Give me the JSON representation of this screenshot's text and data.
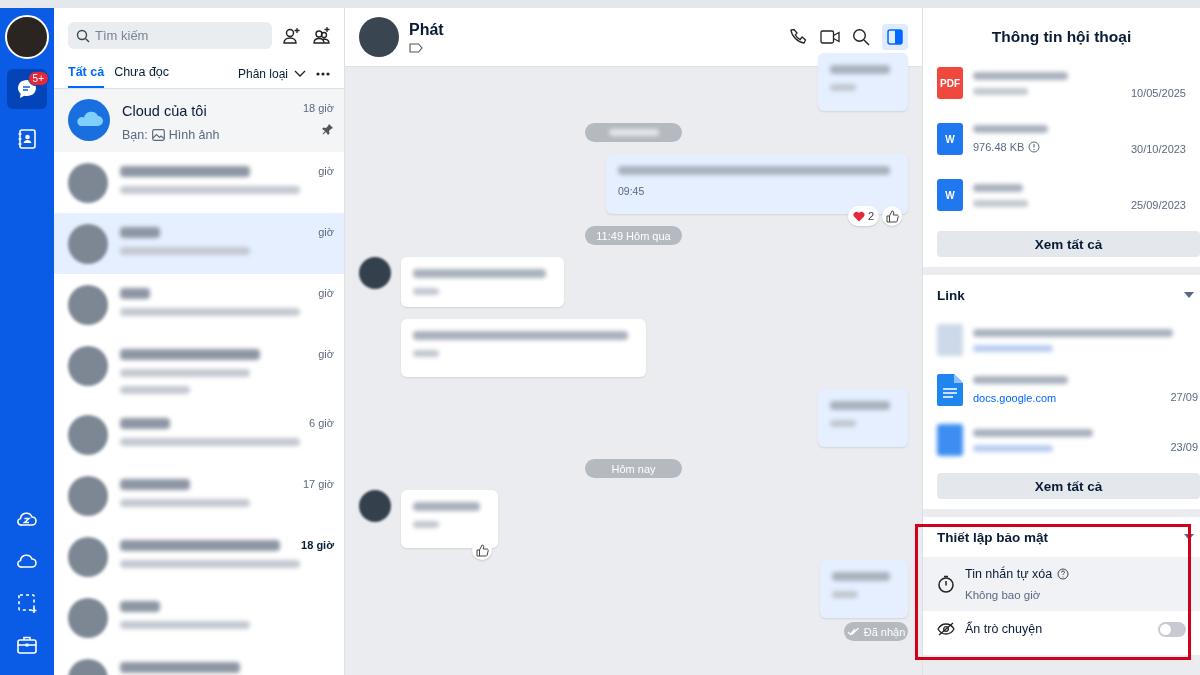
{
  "nav": {
    "badge": "5+",
    "items": [
      {
        "kind": "chat",
        "selected": true
      },
      {
        "kind": "contacts",
        "selected": false
      }
    ],
    "bottom": [
      {
        "kind": "cloud-z"
      },
      {
        "kind": "cloud"
      },
      {
        "kind": "capture"
      },
      {
        "kind": "briefcase"
      }
    ]
  },
  "chat_list": {
    "search": {
      "placeholder": "Tìm kiếm"
    },
    "tabs": [
      {
        "label": "Tất cả",
        "selected": true
      },
      {
        "label": "Chưa đọc",
        "selected": false
      }
    ],
    "filter": "Phân loại",
    "conversations": [
      {
        "name": "Cloud của tôi",
        "preview_prefix": "Bạn:",
        "preview": "Hình ảnh",
        "time": "18 giờ",
        "pinned": true,
        "selected": false
      },
      {
        "time": "giờ",
        "pinned": false,
        "selected": false
      },
      {
        "time": "giờ",
        "pinned": false,
        "selected": true
      },
      {
        "time": "giờ",
        "pinned": false,
        "selected": false
      },
      {
        "time": "giờ",
        "pinned": false,
        "selected": false
      },
      {
        "time": "6 giờ",
        "pinned": false,
        "selected": false
      },
      {
        "time": "17 giờ",
        "pinned": false,
        "selected": false
      },
      {
        "time": "18 giờ",
        "pinned": false,
        "selected": false,
        "unread": true
      },
      {
        "pinned": false,
        "selected": false
      },
      {
        "pinned": false,
        "selected": false
      }
    ]
  },
  "chat": {
    "name": "Phát",
    "messages": [
      {
        "kind": "out",
        "like": false
      },
      {
        "kind": "date"
      },
      {
        "kind": "out",
        "time": "09:45",
        "reaction_count": "2",
        "like": true
      },
      {
        "kind": "date",
        "label": "11:49 Hôm qua"
      },
      {
        "kind": "in",
        "like": false
      },
      {
        "kind": "in",
        "like": false
      },
      {
        "kind": "out",
        "like": false
      },
      {
        "kind": "date",
        "label": "Hôm nay"
      },
      {
        "kind": "in",
        "like": true
      },
      {
        "kind": "out",
        "like": false
      },
      {
        "kind": "status",
        "label": "Đã nhận"
      }
    ]
  },
  "info": {
    "title": "Thông tin hội thoại",
    "files": [
      {
        "icon_label": "PDF",
        "kind": "pdf",
        "date": "10/05/2025"
      },
      {
        "icon_label": "W",
        "kind": "word",
        "size": "976.48 KB",
        "date": "30/10/2023"
      },
      {
        "icon_label": "W",
        "kind": "word",
        "date": "25/09/2023"
      }
    ],
    "files_button": "Xem tất cả",
    "link_section": "Link",
    "links": [
      {
        "kind": "web"
      },
      {
        "kind": "doc",
        "domain": "docs.google.com",
        "date": "27/09"
      },
      {
        "kind": "docblur",
        "date": "23/09"
      }
    ],
    "links_button": "Xem tất cả",
    "security": {
      "title": "Thiết lập bảo mật",
      "items": [
        {
          "kind": "timer",
          "label": "Tin nhắn tự xóa",
          "value": "Không bao giờ"
        },
        {
          "kind": "toggle",
          "label": "Ẩn trò chuyện",
          "on": false
        }
      ]
    }
  }
}
